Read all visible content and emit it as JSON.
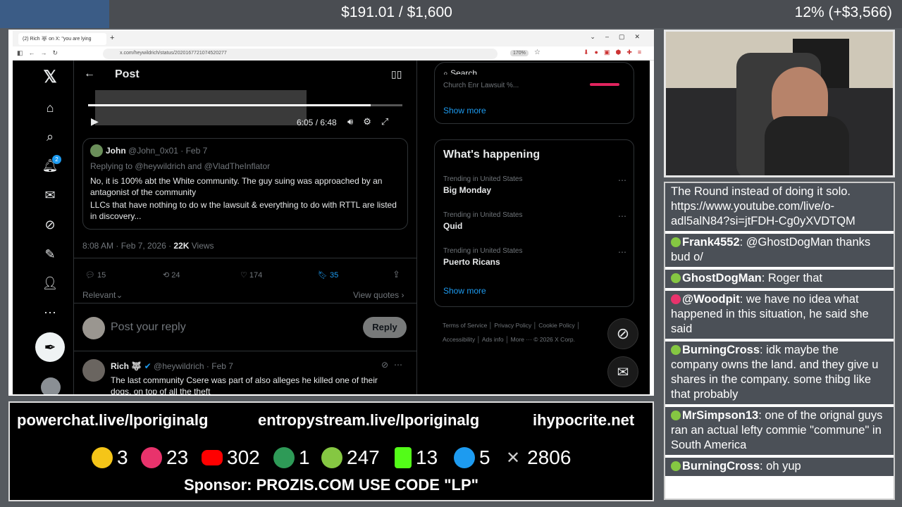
{
  "stream": {
    "goal_text": "$191.01 / $1,600",
    "goal_pct": "12% (+$3,566)",
    "links": [
      "powerchat.live/lporiginalg",
      "entropystream.live/lporiginalg",
      "ihypocrite.net"
    ],
    "stats": [
      {
        "icon": "rumble-face-icon",
        "value": "3",
        "color": "#f5c518"
      },
      {
        "icon": "kick-star-icon",
        "value": "23",
        "color": "#e8336c"
      },
      {
        "icon": "youtube-icon",
        "value": "302",
        "color": "#ff0000"
      },
      {
        "icon": "orb-icon",
        "value": "1",
        "color": "#2e9a57"
      },
      {
        "icon": "rumble-play-icon",
        "value": "247",
        "color": "#85c742"
      },
      {
        "icon": "kick-icon",
        "value": "13",
        "color": "#53fc18"
      },
      {
        "icon": "moon-icon",
        "value": "5",
        "color": "#1d9bf0"
      },
      {
        "icon": "x-icon",
        "value": "2806",
        "color": "#cccccc"
      }
    ],
    "sponsor": "Sponsor: PROZIS.COM USE CODE \"LP\""
  },
  "browser": {
    "tab_title": "(2) Rich 🐺 on X: \"you are lying",
    "url": "x.com/heywildrich/status/2020167721074520277",
    "zoom": "170%"
  },
  "x": {
    "header_title": "Post",
    "video": {
      "time": "6:05 / 6:48",
      "progress": 0.9
    },
    "quote": {
      "name": "John",
      "handle": "@John_0x01 · Feb 7",
      "replying": "Replying to @heywildrich and @VladTheInflator",
      "text1": "No, it is 100% abt the White community. The guy suing was approached by an antagonist of the community",
      "text2": "LLCs  that have nothing to do w the lawsuit & everything to do with RTTL are listed in discovery..."
    },
    "meta_time": "8:08 AM · Feb 7, 2026 · ",
    "meta_views": "22K",
    "meta_views_label": " Views",
    "actions": {
      "replies": "15",
      "reposts": "24",
      "likes": "174",
      "bookmarks": "35"
    },
    "relevant": "Relevant",
    "view_quotes": "View quotes",
    "reply_placeholder": "Post your reply",
    "reply_button": "Reply",
    "notif_count": "2",
    "reply_tweet": {
      "name": "Rich 🐺",
      "handle": "@heywildrich · Feb 7",
      "text": "The last community Csere was part of also alleges he killed one of their dogs, on top of all the theft"
    },
    "search_placeholder": "Search",
    "partial_trend": "Church Enr Lawsuit %...",
    "show_more": "Show more",
    "whats_happening": "What's happening",
    "trends": [
      {
        "context": "Trending in United States",
        "title": "Big Monday"
      },
      {
        "context": "Trending in United States",
        "title": "Quid"
      },
      {
        "context": "Trending in United States",
        "title": "Puerto Ricans"
      }
    ],
    "footer": [
      "Terms of Service",
      "Privacy Policy",
      "Cookie Policy",
      "Accessibility",
      "Ads info",
      "More ···",
      "© 2026 X Corp."
    ]
  },
  "chat": [
    {
      "user": "",
      "text": "The Round instead of doing it solo. https://www.youtube.com/live/o-adl5alN84?si=jtFDH-Cg0yXVDTQM",
      "badge_color": ""
    },
    {
      "user": "Frank4552",
      "text": ": @GhostDogMan thanks bud o/",
      "badge_color": "#85c742"
    },
    {
      "user": "GhostDogMan",
      "text": ": Roger that",
      "badge_color": "#85c742"
    },
    {
      "user": "@Woodpit",
      "text": ": we have no idea what happened in this situation, he said she said",
      "badge_color": "#e8336c"
    },
    {
      "user": "BurningCross",
      "text": ": idk maybe the company owns the land. and they give u shares in the company. some thibg like that probably",
      "badge_color": "#85c742"
    },
    {
      "user": "MrSimpson13",
      "text": ": one of the orignal guys ran an actual lefty commie \"commune\" in South America",
      "badge_color": "#85c742"
    },
    {
      "user": "BurningCross",
      "text": ": oh yup",
      "badge_color": "#85c742"
    }
  ]
}
